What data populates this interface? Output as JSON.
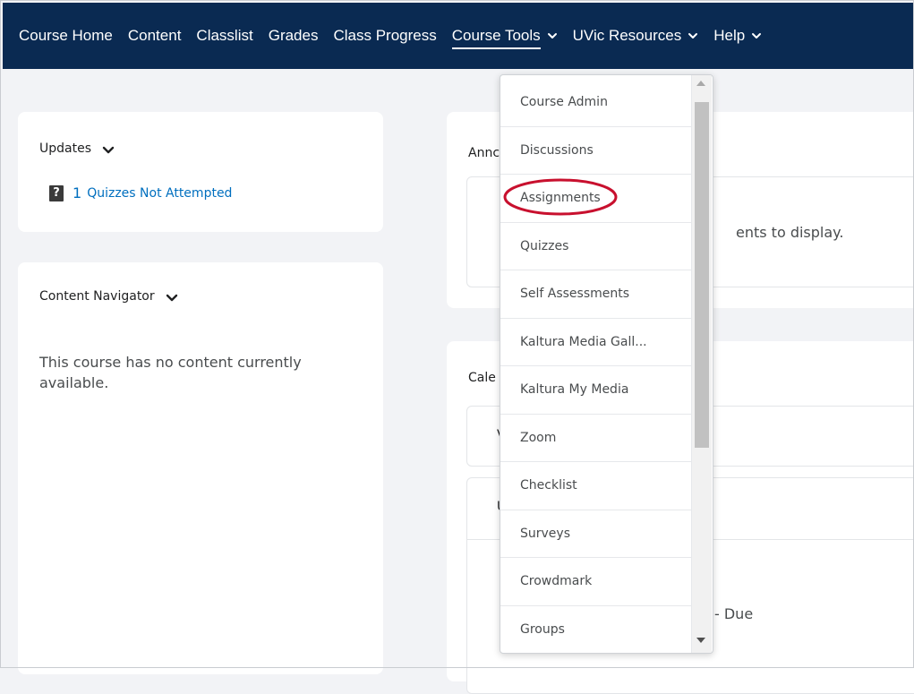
{
  "nav": {
    "items": [
      {
        "label": "Course Home"
      },
      {
        "label": "Content"
      },
      {
        "label": "Classlist"
      },
      {
        "label": "Grades"
      },
      {
        "label": "Class Progress"
      },
      {
        "label": "Course Tools",
        "active": true,
        "dropdown": true
      },
      {
        "label": "UVic Resources",
        "dropdown": true
      },
      {
        "label": "Help",
        "dropdown": true
      }
    ]
  },
  "updates": {
    "title": "Updates",
    "count": "1",
    "link": "Quizzes Not Attempted",
    "icon": "question-icon"
  },
  "navigator": {
    "title": "Content Navigator",
    "empty_text": "This course has no content currently available."
  },
  "announcements": {
    "title_partial": "Annc",
    "empty_partial": "ents to display."
  },
  "calendar": {
    "title_partial": "Cale",
    "box1_partial": "V",
    "box2_partial": "U",
    "due_partial": "- Due"
  },
  "dropdown": {
    "items": [
      "Course Admin",
      "Discussions",
      "Assignments",
      "Quizzes",
      "Self Assessments",
      "Kaltura Media Gall...",
      "Kaltura My Media",
      "Zoom",
      "Checklist",
      "Surveys",
      "Crowdmark",
      "Groups"
    ],
    "highlighted": "Assignments"
  },
  "colors": {
    "navbar": "#0a2a52",
    "link": "#006fbf",
    "highlight": "#c8102e"
  }
}
